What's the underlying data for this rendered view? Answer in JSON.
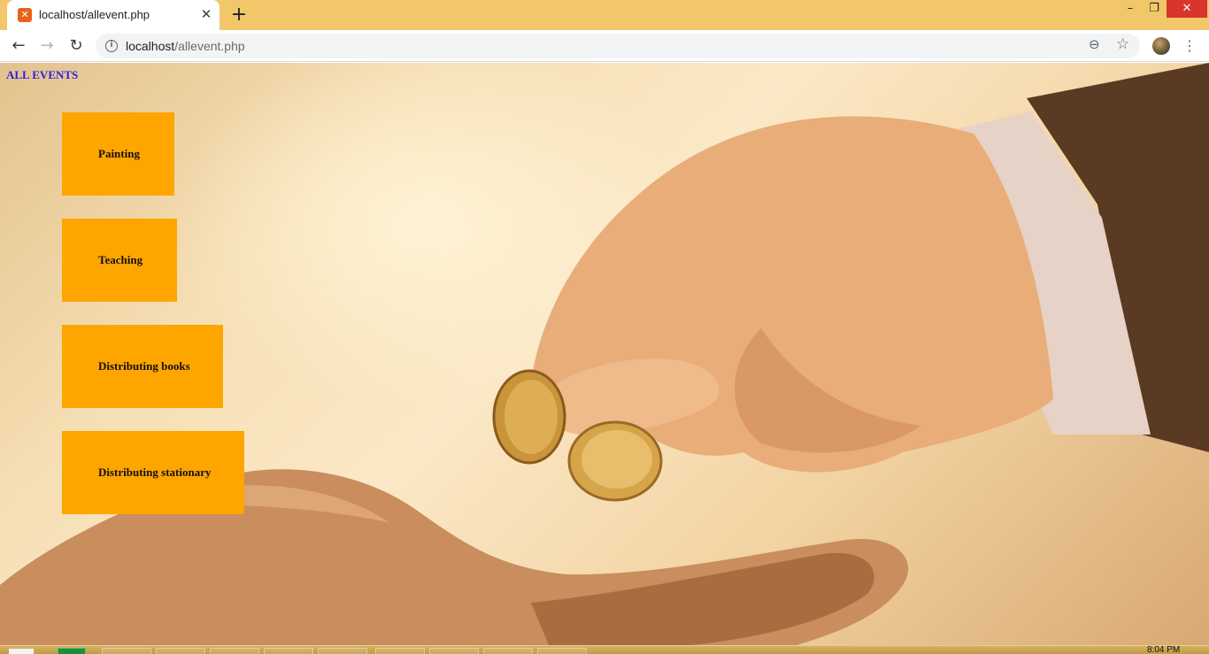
{
  "browser": {
    "tab_title": "localhost/allevent.php",
    "tab_close_glyph": "✕",
    "new_tab_glyph": "+",
    "url_host": "localhost",
    "url_path": "/allevent.php",
    "icons": [
      "xampp-favicon-icon",
      "back-arrow-icon",
      "forward-arrow-icon",
      "reload-icon",
      "info-icon",
      "zoom-out-icon",
      "bookmark-star-icon",
      "profile-avatar",
      "menu-kebab-icon"
    ],
    "window_controls": {
      "minimize": "–",
      "restore": "❐",
      "close": "✕"
    }
  },
  "page": {
    "heading": "ALL EVENTS",
    "heading_color": "#2b1ee6",
    "button_color": "#ffa500",
    "events": [
      {
        "label": "Painting"
      },
      {
        "label": "Teaching"
      },
      {
        "label": "Distributing books"
      },
      {
        "label": "Distributing stationary"
      }
    ]
  },
  "taskbar": {
    "clock": "8:04 PM"
  }
}
